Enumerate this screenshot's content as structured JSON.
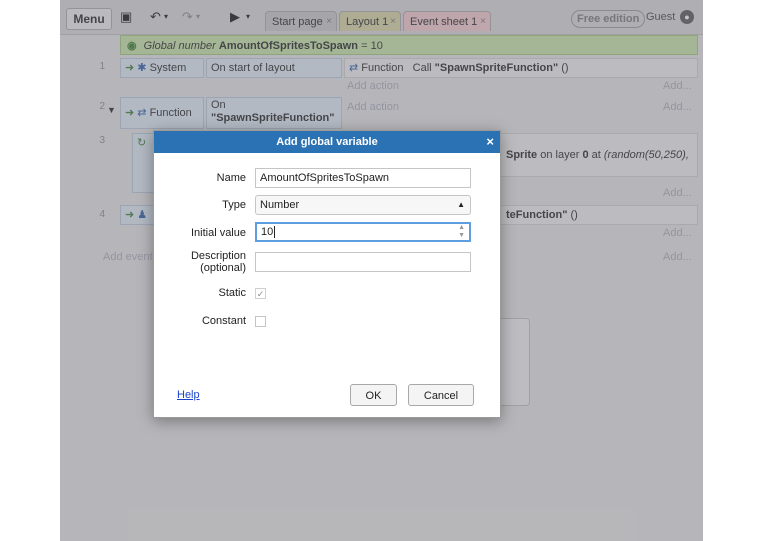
{
  "toolbar": {
    "menu_label": "Menu",
    "tabs": [
      {
        "label": "Start page",
        "close": "×"
      },
      {
        "label": "Layout 1",
        "close": "×"
      },
      {
        "label": "Event sheet 1",
        "close": "×"
      }
    ],
    "edition": "Free edition",
    "user": "Guest",
    "colors": {
      "toolbar": "#d8d8d8",
      "event_sheet_tab": "#f3c6cc",
      "layout_tab": "#d7d2a3"
    }
  },
  "event_sheet": {
    "global_var": {
      "prefix": "Global number",
      "name": "AmountOfSpritesToSpawn",
      "suffix": "= 10"
    },
    "row_numbers": [
      "1",
      "2",
      "3",
      "4"
    ],
    "event1": {
      "object": "System",
      "condition": "On start of layout",
      "action_object": "Function",
      "action_text": "Call",
      "action_arg": "\"SpawnSpriteFunction\"",
      "action_tail": "()",
      "add_action": "Add action",
      "add": "Add..."
    },
    "event2": {
      "object": "Function",
      "condition_line1": "On",
      "condition_line2": "\"SpawnSpriteFunction\"",
      "add_action": "Add action",
      "add": "Add..."
    },
    "event3": {
      "sprite_word": "Sprite",
      "on_layer": "on layer",
      "layer": "0",
      "at": "at",
      "random": "(random(50,250),",
      "add": "Add..."
    },
    "event4": {
      "action_text": "teFunction\"",
      "action_tail": "()",
      "add": "Add..."
    },
    "add_event": "Add event",
    "add_right": "Add..."
  },
  "dialog": {
    "title": "Add global variable",
    "close": "×",
    "fields": {
      "name_label": "Name",
      "name_value": "AmountOfSpritesToSpawn",
      "type_label": "Type",
      "type_value": "Number",
      "initial_label": "Initial value",
      "initial_value": "10",
      "description_label_1": "Description",
      "description_label_2": "(optional)",
      "description_value": "",
      "static_label": "Static",
      "static_checked": true,
      "constant_label": "Constant",
      "constant_checked": false
    },
    "help_link": "Help",
    "ok_button": "OK",
    "cancel_button": "Cancel",
    "colors": {
      "title_bar": "#2b72b5",
      "focus_ring": "#5e9ee0"
    }
  }
}
